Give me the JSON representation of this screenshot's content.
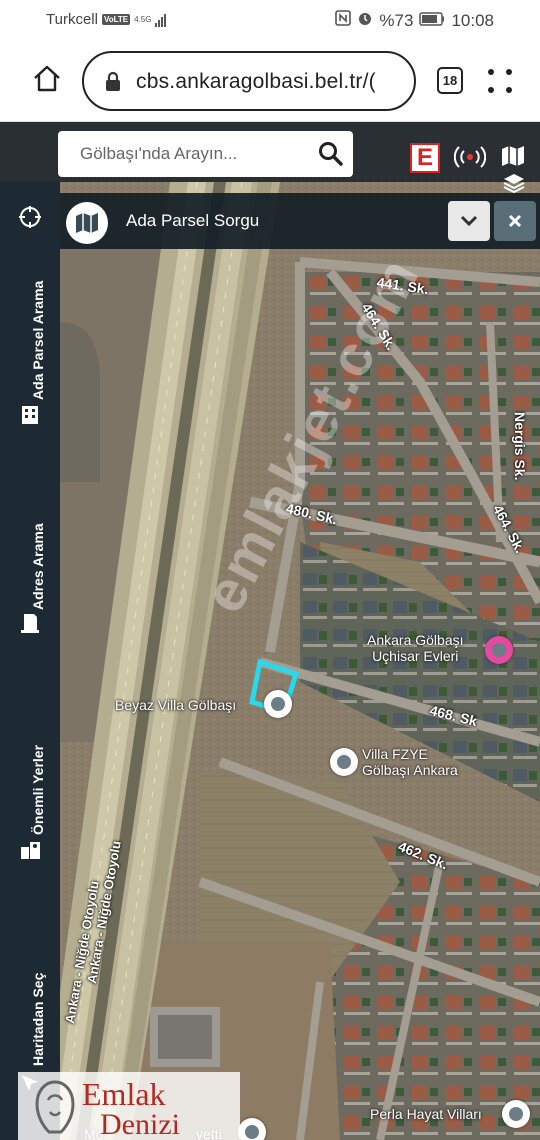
{
  "status_bar": {
    "carrier": "Turkcell",
    "volte": "VoLTE",
    "network": "4.5G",
    "battery": "%73",
    "time": "10:08"
  },
  "browser": {
    "url": "cbs.ankaragolbasi.bel.tr/(",
    "tab_count": "18"
  },
  "toolbar": {
    "search_placeholder": "Gölbaşı'nda Arayın...",
    "e_logo": "E"
  },
  "sidebar": {
    "tabs": [
      {
        "label": "Ada Parsel Arama",
        "icon": "building-icon"
      },
      {
        "label": "Adres Arama",
        "icon": "address-icon"
      },
      {
        "label": "Önemli Yerler",
        "icon": "places-icon"
      },
      {
        "label": "Haritadan Seç",
        "icon": "select-map-icon"
      }
    ]
  },
  "panel": {
    "title": "Ada Parsel Sorgu"
  },
  "map": {
    "streets": [
      "441. Sk.",
      "464. Sk.",
      "480. Sk.",
      "464. Sk.",
      "468. Sk",
      "462. Sk.",
      "Nergis Sk."
    ],
    "highway": "Ankara - Niğde Otoyolu",
    "highway2": "Ankara - Niğde Otoyolu",
    "pois": {
      "uchisar": "Ankara Gölbaşı\nUçhisar Evleri",
      "beyaz_villa": "Beyaz Villa Gölbaşı",
      "villa_fzye": "Villa FZYE\nGölbaşı Ankara",
      "perla": "Perla Hayat Vilları",
      "bottom_left": "Mo",
      "bottom_mid": "yetti"
    },
    "watermark": "emlakjet.com",
    "parcel_color": "#27d9ea"
  },
  "branding": {
    "line1": "Emlak",
    "line2": "Denizi"
  }
}
